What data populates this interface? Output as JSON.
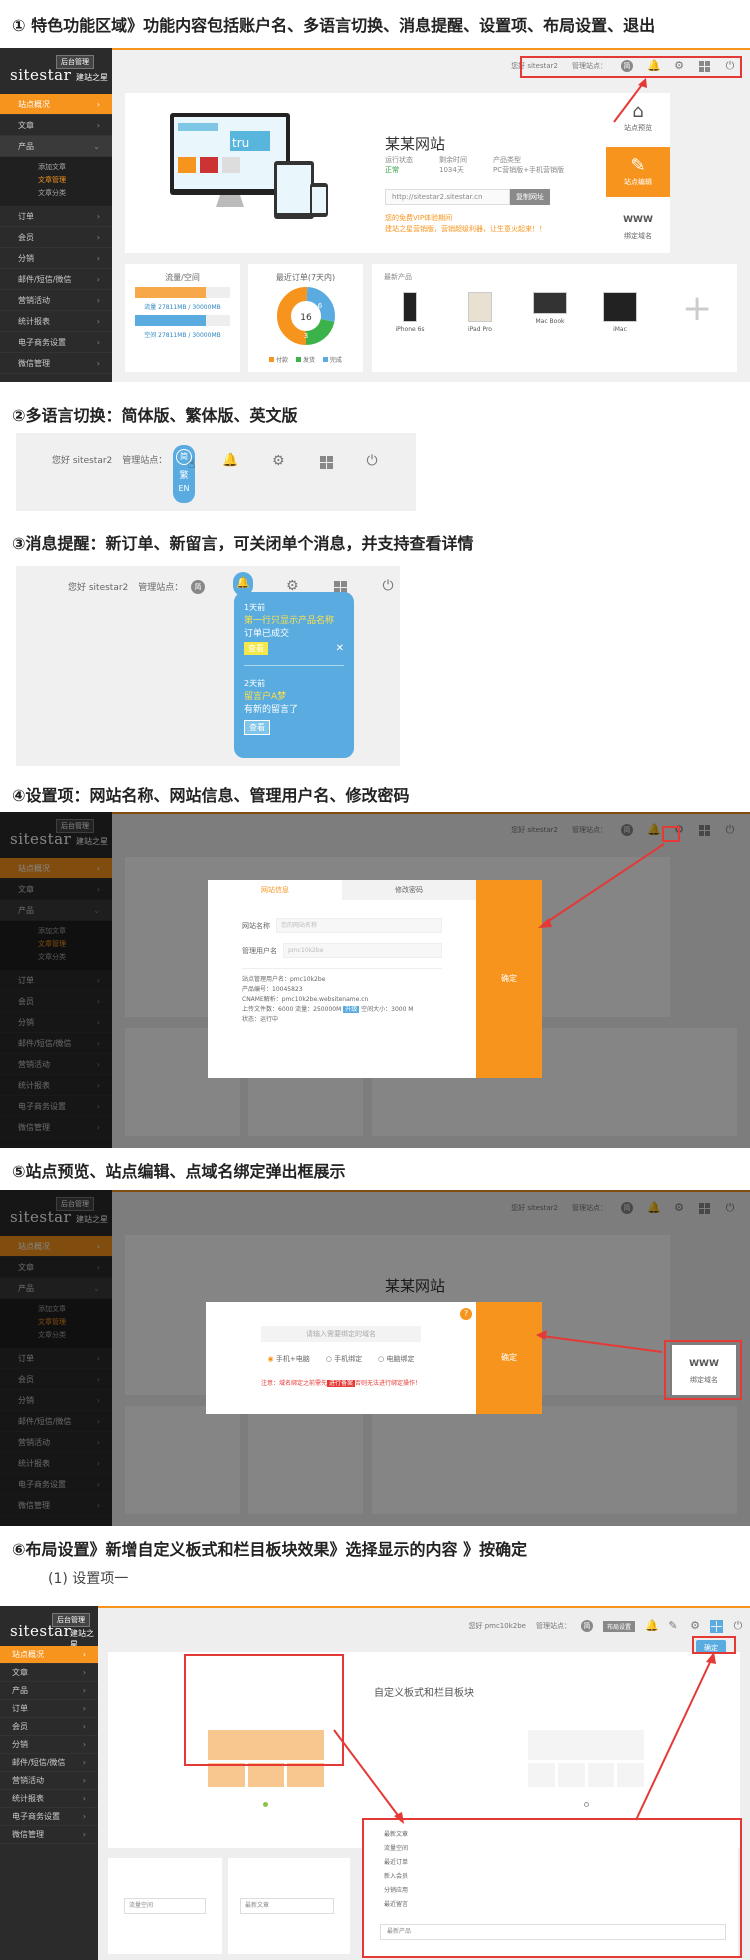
{
  "headings": {
    "h1": "① 特色功能区域》功能内容包括账户名、多语言切换、消息提醒、设置项、布局设置、退出",
    "h2": "②多语言切换：简体版、繁体版、英文版",
    "h3": "③消息提醒：新订单、新留言，可关闭单个消息，并支持查看详情",
    "h4": "④设置项：网站名称、网站信息、管理用户名、修改密码",
    "h5": "⑤站点预览、站点编辑、点域名绑定弹出框展示",
    "h6": "⑥布局设置》新增自定义板式和栏目板块效果》选择显示的内容 》按确定",
    "h6_sub": "(1)  设置项一"
  },
  "brand": {
    "logo": "sitestar",
    "logo_sub": "建站之星",
    "badge": "后台管理"
  },
  "sidebar": {
    "items": [
      "站点概况",
      "文章",
      "产品",
      "订单",
      "会员",
      "分销",
      "邮件/短信/微信",
      "营销活动",
      "统计报表",
      "电子商务设置",
      "微信管理"
    ],
    "sub_items": [
      "添加文章",
      "文章管理",
      "文章分类"
    ]
  },
  "sidebar6": {
    "items": [
      "站点概况",
      "文章",
      "产品",
      "订单",
      "会员",
      "分销",
      "邮件/短信/微信",
      "营销活动",
      "统计报表",
      "电子商务设置",
      "微信管理"
    ]
  },
  "topbar": {
    "greeting": "您好 sitestar2",
    "manage": "管理站点：",
    "lang_short": "简",
    "greeting6": "您好 pmc10k2be",
    "layout_btn": "布局设置",
    "confirm": "确定"
  },
  "site": {
    "name": "某某网站",
    "status_label": "运行状态",
    "status": "正常",
    "days_label": "剩余时间",
    "days": "1034天",
    "type_label": "产品类型",
    "type": "PC营销版+手机营销版",
    "url": "http://sitestar2.sitestar.cn",
    "copy_btn": "复制网址",
    "tip1": "您的免费VIP体验期间",
    "tip2": "建站之星营销版，营销超级利器，让生意火起来！！"
  },
  "actions": {
    "preview": "站点预览",
    "edit": "站点编辑",
    "bind": "绑定域名"
  },
  "stats": {
    "traffic_title": "流量/空间",
    "traffic_text": "流量 27811MB / 30000MB",
    "space_text": "空间 27811MB / 30000MB",
    "orders_title": "最近订单(7天内)",
    "donut_center": "16",
    "donut_a": "6",
    "donut_b": "3",
    "legend": [
      "付款",
      "发货",
      "完成"
    ],
    "products_title": "最新产品",
    "products": [
      "iPhone 6s",
      "iPad Pro",
      "Mac Book",
      "iMac"
    ]
  },
  "lang": {
    "simplified": "简",
    "traditional": "繁",
    "english": "EN"
  },
  "messages": [
    {
      "time": "1天前",
      "title": "第一行只显示产品名称",
      "body": "订单已成交",
      "btn": "查看"
    },
    {
      "time": "2天前",
      "title": "留言户A梦",
      "body": "有新的留言了",
      "btn": "查看"
    }
  ],
  "settings_modal": {
    "tab1": "网站信息",
    "tab2": "修改密码",
    "name_label": "网站名称",
    "name_ph": "您的网站名称",
    "user_label": "管理用户名",
    "user_ph": "pmc10k2be",
    "info": [
      "站点管理用户名：pmc10k2be",
      "产品编号：10045823",
      "CNAME解析：pmc10k2be.websitename.cn",
      "上传文件数：6000   流量：250000M",
      "状态：运行中"
    ],
    "upload_btn": "升级",
    "space": "空间大小：3000 M",
    "confirm": "确定"
  },
  "bind_modal": {
    "placeholder": "请输入需要绑定的域名",
    "opt1": "手机+电脑",
    "opt2": "手机绑定",
    "opt3": "电脑绑定",
    "note": "注意：域名绑定之前需先",
    "note_link": "进行备案",
    "note_tail": "否则无法进行绑定操作！",
    "confirm": "确定"
  },
  "layout": {
    "title": "自定义板式和栏目板块",
    "options": [
      "最新文章",
      "流量空间",
      "最近订单",
      "新入会员",
      "分销应用",
      "最近留言"
    ],
    "select": "最新产品",
    "sel1": "流量空间",
    "sel2": "最新文章"
  },
  "colors": {
    "accent": "#f7941d",
    "sidebar": "#2b2b2b",
    "highlight": "#e53935",
    "blue": "#5aace0"
  }
}
